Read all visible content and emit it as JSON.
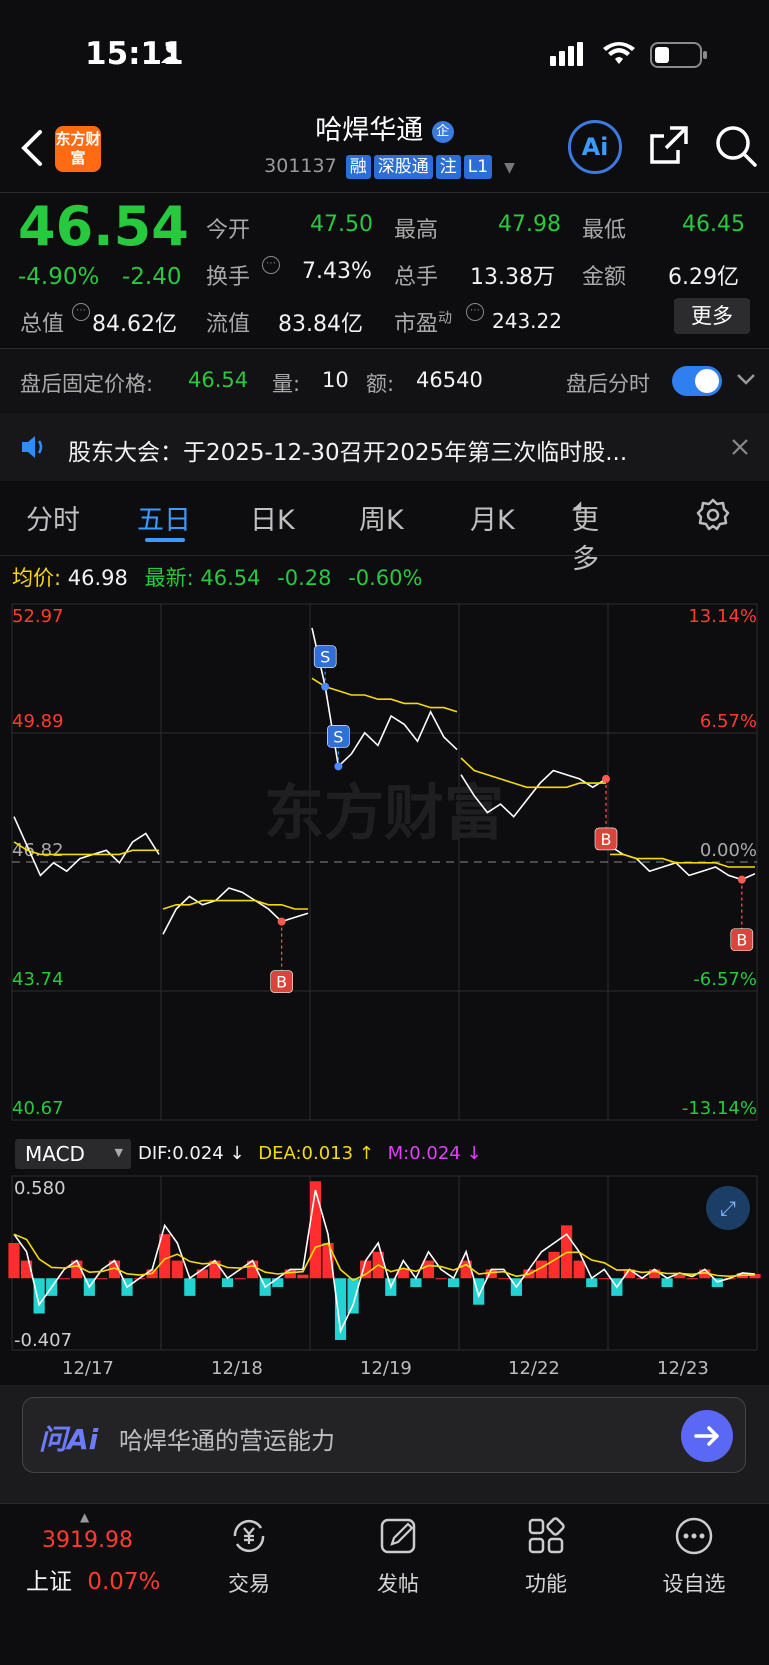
{
  "status_bar": {
    "time": "15:11"
  },
  "header": {
    "logo_text": "东方财富",
    "title": "哈焊华通",
    "title_badge": "企",
    "code": "301137",
    "tags": [
      "融",
      "深股通",
      "注",
      "L1"
    ]
  },
  "quote": {
    "price": "46.54",
    "change_pct": "-4.90%",
    "change": "-2.40",
    "open_label": "今开",
    "open": "47.50",
    "high_label": "最高",
    "high": "47.98",
    "low_label": "最低",
    "low": "46.45",
    "turnover_label": "换手",
    "turnover": "7.43%",
    "volume_label": "总手",
    "volume": "13.38万",
    "amount_label": "金额",
    "amount": "6.29亿",
    "total_value_label": "总值",
    "total_value": "84.62亿",
    "float_value_label": "流值",
    "float_value": "83.84亿",
    "pe_label": "市盈",
    "pe_sup": "动",
    "pe": "243.22",
    "more_button": "更多"
  },
  "after_hours": {
    "price_label": "盘后固定价格:",
    "price": "46.54",
    "qty_label": "量:",
    "qty": "10",
    "amount_label": "额:",
    "amount": "46540",
    "intraday_label": "盘后分时"
  },
  "notice": {
    "text": "股东大会：于2025-12-30召开2025年第三次临时股..."
  },
  "tabs": {
    "items": [
      "分时",
      "五日",
      "日K",
      "周K",
      "月K",
      "更多"
    ],
    "active": "五日"
  },
  "price_info": {
    "avg_label": "均价:",
    "avg": "46.98",
    "latest_label": "最新:",
    "latest": "46.54",
    "change": "-0.28",
    "change_pct": "-0.60%"
  },
  "chart_data": [
    {
      "type": "line",
      "title": "",
      "x": [
        "12/17",
        "12/18",
        "12/19",
        "12/22",
        "12/23"
      ],
      "y_ticks_left": [
        "52.97",
        "49.89",
        "46.82",
        "43.74",
        "40.67"
      ],
      "y_ticks_right": [
        "13.14%",
        "6.57%",
        "0.00%",
        "-6.57%",
        "-13.14%"
      ],
      "ylim": [
        40.67,
        52.97
      ],
      "series": [
        {
          "name": "",
          "color": "#ffffff",
          "values": [
            47.9,
            47.2,
            46.5,
            46.8,
            46.6,
            46.9,
            47.0,
            47.1,
            46.8,
            47.3,
            47.5,
            47.0,
            45.1,
            45.7,
            46.0,
            45.8,
            45.9,
            46.2,
            46.1,
            45.9,
            45.7,
            45.4,
            45.5,
            45.6,
            52.4,
            51.0,
            49.1,
            49.4,
            49.9,
            49.6,
            50.3,
            50.1,
            49.7,
            50.4,
            49.8,
            49.5,
            48.9,
            48.4,
            48.0,
            48.2,
            47.9,
            48.3,
            48.7,
            49.0,
            48.9,
            48.8,
            48.6,
            48.8,
            47.2,
            47.0,
            46.9,
            46.6,
            46.7,
            46.8,
            46.5,
            46.6,
            46.7,
            46.5,
            46.4,
            46.54
          ]
        },
        {
          "name": "",
          "color": "#f5d90a",
          "values": [
            47.3,
            47.1,
            47.0,
            47.0,
            47.0,
            47.0,
            47.0,
            47.0,
            47.0,
            47.1,
            47.1,
            47.1,
            45.7,
            45.8,
            45.8,
            45.9,
            45.9,
            45.9,
            45.9,
            45.9,
            45.8,
            45.8,
            45.7,
            45.7,
            51.2,
            51.0,
            50.9,
            50.8,
            50.8,
            50.7,
            50.7,
            50.6,
            50.6,
            50.5,
            50.5,
            50.4,
            49.3,
            49.0,
            48.9,
            48.8,
            48.7,
            48.6,
            48.6,
            48.6,
            48.6,
            48.7,
            48.7,
            48.7,
            47.0,
            47.0,
            46.9,
            46.9,
            46.9,
            46.8,
            46.8,
            46.8,
            46.8,
            46.7,
            46.7,
            46.7
          ]
        }
      ],
      "markers": [
        {
          "label": "S",
          "x_index": 25,
          "value": 51.0
        },
        {
          "label": "S",
          "x_index": 26,
          "value": 49.1
        },
        {
          "label": "B",
          "x_index": 21,
          "value": 45.4
        },
        {
          "label": "B",
          "x_index": 47,
          "value": 48.8
        },
        {
          "label": "B",
          "x_index": 58,
          "value": 46.4
        }
      ],
      "watermark": "东方财富"
    },
    {
      "type": "bar",
      "title": "MACD",
      "indicator_values": {
        "DIF": "DIF:0.024",
        "DEA": "DEA:0.013",
        "M": "M:0.024"
      },
      "y_ticks": [
        "0.580",
        "-0.407"
      ],
      "ylim": [
        -0.407,
        0.58
      ],
      "x": [
        "12/17",
        "12/18",
        "12/19",
        "12/22",
        "12/23"
      ],
      "series": [
        {
          "name": "M",
          "values": [
            0.2,
            0.1,
            -0.2,
            -0.1,
            0.0,
            0.1,
            -0.1,
            0.0,
            0.1,
            -0.1,
            0.0,
            0.05,
            0.25,
            0.1,
            -0.1,
            0.05,
            0.1,
            -0.05,
            0.0,
            0.1,
            -0.1,
            -0.05,
            0.05,
            0.02,
            0.55,
            0.2,
            -0.35,
            -0.2,
            0.1,
            0.15,
            -0.1,
            0.05,
            -0.05,
            0.1,
            0.0,
            -0.05,
            0.1,
            -0.15,
            0.05,
            0.0,
            -0.1,
            0.05,
            0.1,
            0.15,
            0.3,
            0.1,
            -0.05,
            0.0,
            -0.1,
            0.05,
            0.0,
            0.05,
            -0.05,
            0.02,
            0.0,
            0.05,
            -0.05,
            0.0,
            0.03,
            0.024
          ]
        },
        {
          "name": "DIF",
          "values": [
            0.25,
            0.15,
            -0.15,
            -0.05,
            0.05,
            0.1,
            -0.05,
            0.05,
            0.1,
            -0.05,
            0.0,
            0.05,
            0.3,
            0.2,
            0.0,
            0.05,
            0.1,
            0.0,
            0.05,
            0.1,
            -0.05,
            0.0,
            0.05,
            0.05,
            0.5,
            0.25,
            -0.3,
            -0.15,
            0.1,
            0.2,
            -0.05,
            0.1,
            0.0,
            0.15,
            0.05,
            0.0,
            0.15,
            -0.1,
            0.05,
            0.05,
            -0.05,
            0.05,
            0.15,
            0.2,
            0.25,
            0.15,
            0.0,
            0.05,
            -0.05,
            0.05,
            0.0,
            0.05,
            0.0,
            0.03,
            0.01,
            0.05,
            -0.02,
            0.0,
            0.03,
            0.024
          ]
        }
      ]
    }
  ],
  "ai_bar": {
    "logo": "问Ai",
    "placeholder": "哈焊华通的营运能力"
  },
  "bottom_nav": {
    "index_value": "3919.98",
    "index_name": "上证",
    "index_change": "0.07%",
    "items": [
      "交易",
      "发帖",
      "功能",
      "设自选"
    ]
  }
}
